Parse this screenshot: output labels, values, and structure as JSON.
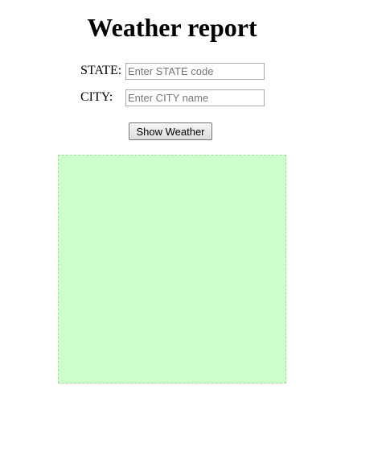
{
  "page": {
    "title": "Weather report"
  },
  "form": {
    "state": {
      "label": "STATE:",
      "placeholder": "Enter STATE code",
      "value": ""
    },
    "city": {
      "label": "CITY:",
      "placeholder": "Enter CITY name",
      "value": ""
    },
    "submit_label": "Show Weather"
  },
  "result_panel": {
    "background_color": "#ccffcc",
    "border_color": "#a8d8a8"
  }
}
